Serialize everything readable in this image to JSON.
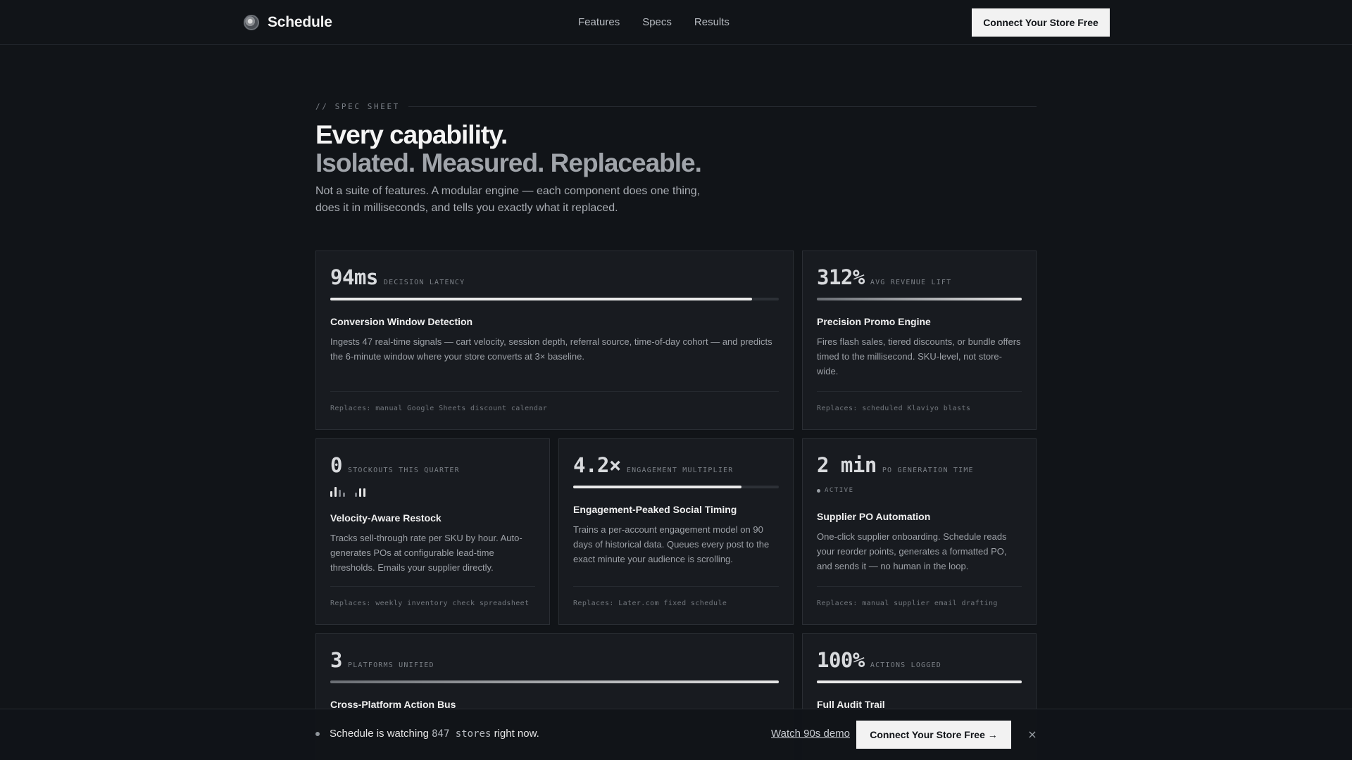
{
  "nav": {
    "brand": "Schedule",
    "links": [
      "Features",
      "Specs",
      "Results"
    ],
    "cta": "Connect Your Store Free"
  },
  "hero": {
    "eyebrow": "// SPEC SHEET",
    "title_line1": "Every capability.",
    "title_line2": "Isolated. Measured. Replaceable.",
    "lede": "Not a suite of features. A modular engine — each component does one thing, does it in milliseconds, and tells you exactly what it replaced."
  },
  "cards": [
    {
      "stat": "94ms",
      "stat_label": "DECISION LATENCY",
      "bar_fraction": 0.94,
      "title": "Conversion Window Detection",
      "desc": "Ingests 47 real-time signals — cart velocity, session depth, referral source, time-of-day cohort — and predicts the 6-minute window where your store converts at 3× baseline.",
      "foot": "Replaces: manual Google Sheets discount calendar"
    },
    {
      "stat": "312%",
      "stat_label": "AVG REVENUE LIFT",
      "bar_fraction": 1.0,
      "title": "Precision Promo Engine",
      "desc": "Fires flash sales, tiered discounts, or bundle offers timed to the millisecond. SKU-level, not store-wide.",
      "foot": "Replaces: scheduled Klaviyo blasts"
    },
    {
      "stat": "0",
      "stat_label": "STOCKOUTS THIS QUARTER",
      "title": "Velocity-Aware Restock",
      "desc": "Tracks sell-through rate per SKU by hour. Auto-generates POs at configurable lead-time thresholds. Emails your supplier directly.",
      "foot": "Replaces: weekly inventory check spreadsheet"
    },
    {
      "stat": "4.2×",
      "stat_label": "ENGAGEMENT MULTIPLIER",
      "bar_fraction": 0.82,
      "title": "Engagement-Peaked Social Timing",
      "desc": "Trains a per-account engagement model on 90 days of historical data. Queues every post to the exact minute your audience is scrolling.",
      "foot": "Replaces: Later.com fixed schedule"
    },
    {
      "stat": "2 min",
      "stat_label": "PO GENERATION TIME",
      "status": "ACTIVE",
      "title": "Supplier PO Automation",
      "desc": "One-click supplier onboarding. Schedule reads your reorder points, generates a formatted PO, and sends it — no human in the loop.",
      "foot": "Replaces: manual supplier email drafting"
    },
    {
      "stat": "3",
      "stat_label": "PLATFORMS UNIFIED",
      "bar_fraction": 1.0,
      "title": "Cross-Platform Action Bus",
      "desc": "",
      "foot": ""
    },
    {
      "stat": "100%",
      "stat_label": "ACTIONS LOGGED",
      "bar_fraction": 1.0,
      "title": "Full Audit Trail",
      "desc": "",
      "foot": ""
    }
  ],
  "bottom_bar": {
    "text_before": "Schedule is watching",
    "count": "847 stores",
    "text_after": "right now.",
    "demo_link": "Watch 90s demo",
    "cta": "Connect Your Store Free →",
    "close": "×"
  },
  "colors": {
    "background": "#111418",
    "card": "#181b20",
    "border": "#2a2e34",
    "accent": "#f2f2f2"
  }
}
